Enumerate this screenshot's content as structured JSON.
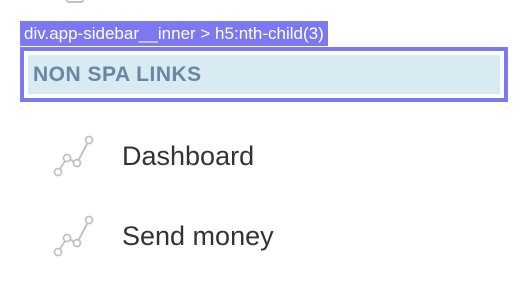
{
  "inspector": {
    "selector_label": "div.app-sidebar__inner > h5:nth-child(3)"
  },
  "sidebar": {
    "section_heading": "NON SPA LINKS",
    "items": [
      {
        "label": "Dashboard",
        "icon": "chart-line-icon"
      },
      {
        "label": "Send money",
        "icon": "chart-line-icon"
      }
    ]
  },
  "colors": {
    "highlight": "#7b78f2",
    "heading_bg": "#d8eaf2",
    "heading_text": "#6a86a3",
    "item_text": "#333333",
    "icon_stroke": "#c2c2c2"
  }
}
